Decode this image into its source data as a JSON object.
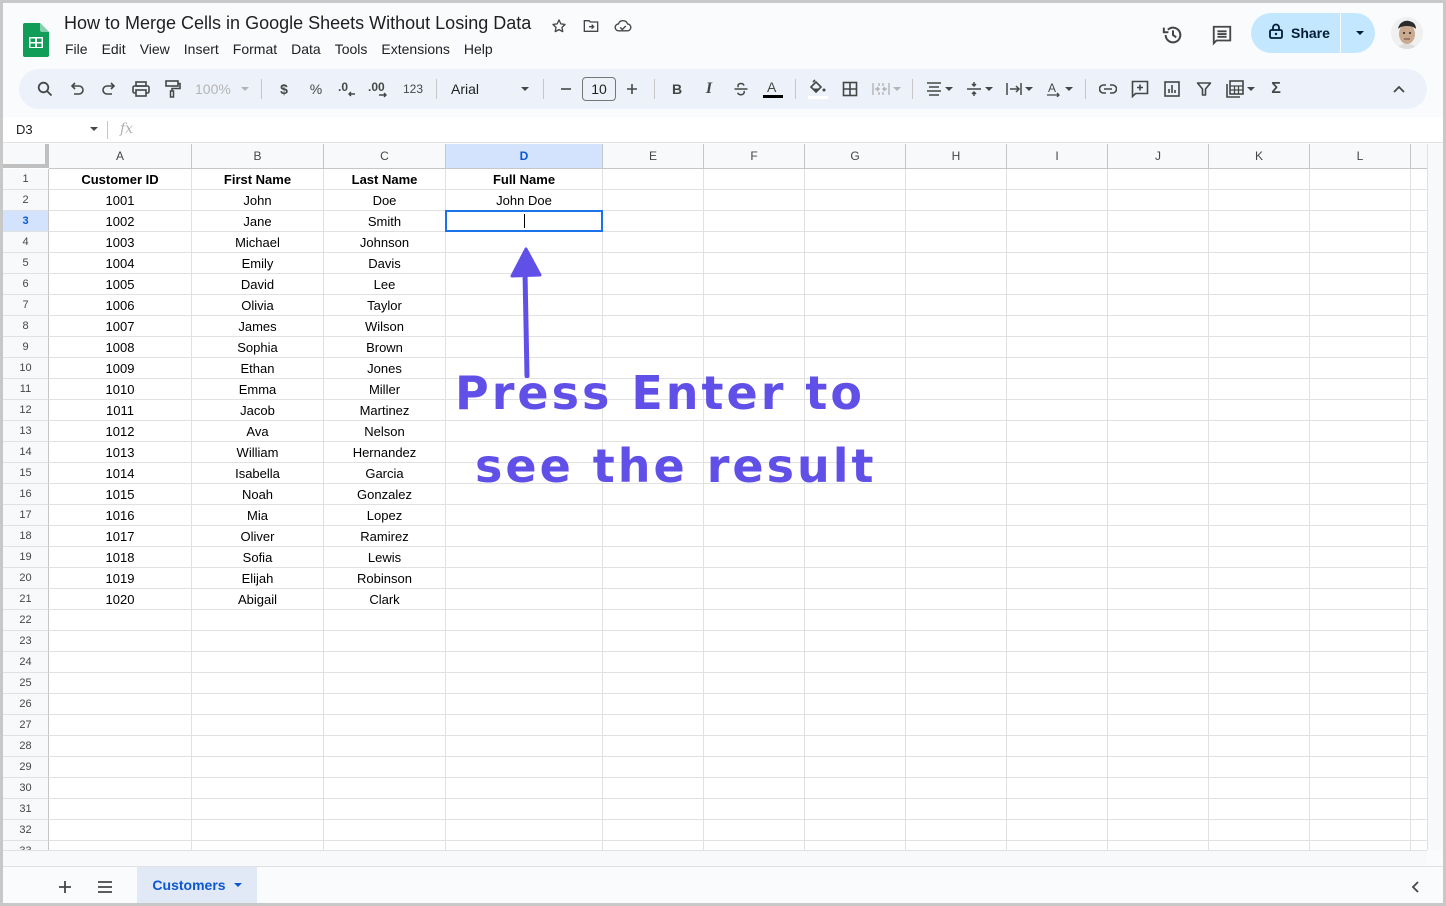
{
  "header": {
    "title": "How to Merge Cells in Google Sheets Without Losing Data",
    "title_icons": [
      "star-icon",
      "move-to-folder-icon",
      "cloud-saved-icon"
    ],
    "menu": [
      "File",
      "Edit",
      "View",
      "Insert",
      "Format",
      "Data",
      "Tools",
      "Extensions",
      "Help"
    ],
    "share_label": "Share",
    "right_icons": [
      "version-history-icon",
      "comments-icon"
    ]
  },
  "toolbar": {
    "zoom": "100%",
    "currency": "$",
    "percent": "%",
    "decrease_decimal": ".0",
    "increase_decimal": ".00",
    "number_format": "123",
    "font": "Arial",
    "font_size": "10",
    "bold": "B",
    "italic": "I",
    "text_color_letter": "A",
    "sum": "Σ"
  },
  "formula_bar": {
    "name_box": "D3",
    "fx": "fx",
    "value": ""
  },
  "grid": {
    "columns": [
      "A",
      "B",
      "C",
      "D",
      "E",
      "F",
      "G",
      "H",
      "I",
      "J",
      "K",
      "L"
    ],
    "selected_column": "D",
    "selected_row": 3,
    "active_cell": "D3",
    "header_row": [
      "Customer ID",
      "First Name",
      "Last Name",
      "Full Name"
    ],
    "rows": [
      [
        "1001",
        "John",
        "Doe",
        "John Doe"
      ],
      [
        "1002",
        "Jane",
        "Smith",
        ""
      ],
      [
        "1003",
        "Michael",
        "Johnson",
        ""
      ],
      [
        "1004",
        "Emily",
        "Davis",
        ""
      ],
      [
        "1005",
        "David",
        "Lee",
        ""
      ],
      [
        "1006",
        "Olivia",
        "Taylor",
        ""
      ],
      [
        "1007",
        "James",
        "Wilson",
        ""
      ],
      [
        "1008",
        "Sophia",
        "Brown",
        ""
      ],
      [
        "1009",
        "Ethan",
        "Jones",
        ""
      ],
      [
        "1010",
        "Emma",
        "Miller",
        ""
      ],
      [
        "1011",
        "Jacob",
        "Martinez",
        ""
      ],
      [
        "1012",
        "Ava",
        "Nelson",
        ""
      ],
      [
        "1013",
        "William",
        "Hernandez",
        ""
      ],
      [
        "1014",
        "Isabella",
        "Garcia",
        ""
      ],
      [
        "1015",
        "Noah",
        "Gonzalez",
        ""
      ],
      [
        "1016",
        "Mia",
        "Lopez",
        ""
      ],
      [
        "1017",
        "Oliver",
        "Ramirez",
        ""
      ],
      [
        "1018",
        "Sofia",
        "Lewis",
        ""
      ],
      [
        "1019",
        "Elijah",
        "Robinson",
        ""
      ],
      [
        "1020",
        "Abigail",
        "Clark",
        ""
      ]
    ],
    "visible_row_count": 33
  },
  "sheets": {
    "tabs": [
      {
        "label": "Customers",
        "active": true
      }
    ]
  },
  "annotation": {
    "line1": "Press Enter to",
    "line2": "see the result",
    "color": "#6150e8"
  },
  "colors": {
    "accent": "#0b57d0",
    "share_bg": "#c2e7ff",
    "selection_border": "#1a73e8",
    "sheets_green": "#0f9d58"
  }
}
